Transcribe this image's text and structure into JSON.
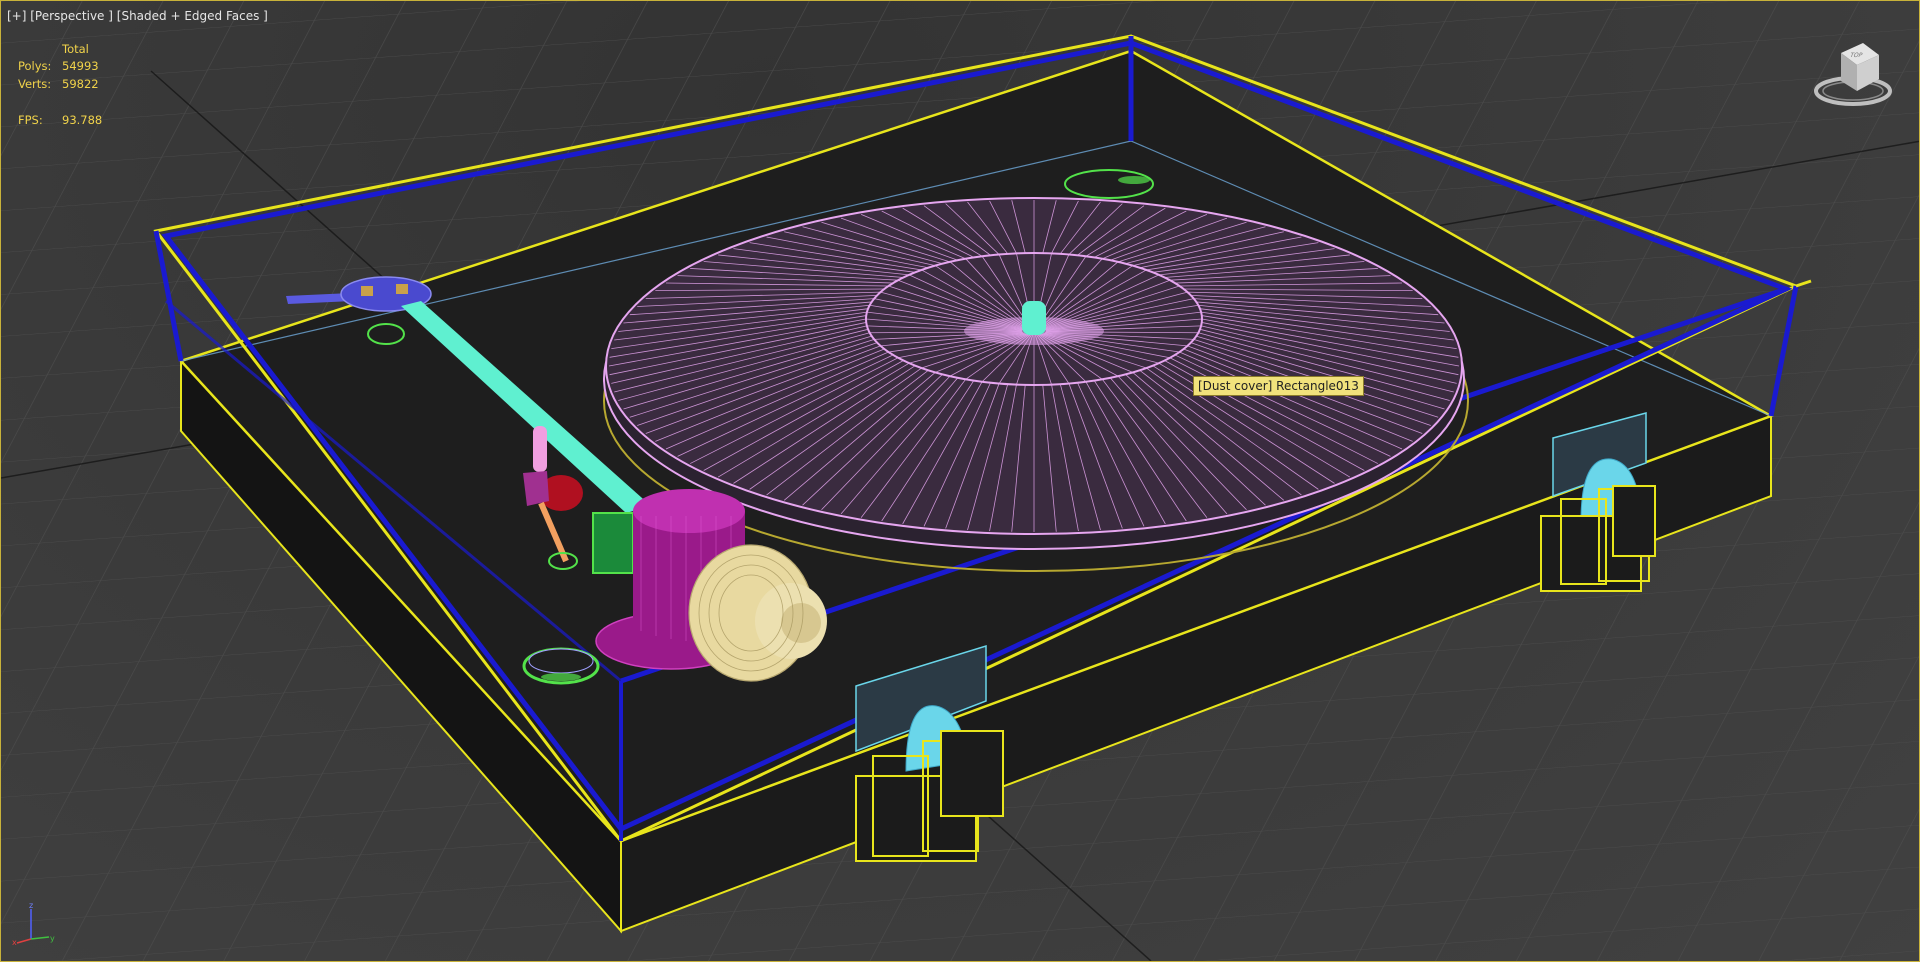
{
  "viewport": {
    "label_plus": "[+]",
    "label_view": "[Perspective ]",
    "label_shading": "[Shaded + Edged Faces ]"
  },
  "stats": {
    "header": "Total",
    "polys_label": "Polys:",
    "polys_value": "54993",
    "verts_label": "Verts:",
    "verts_value": "59822",
    "fps_label": "FPS:",
    "fps_value": "93.788"
  },
  "tooltip": {
    "text": "[Dust cover] Rectangle013"
  },
  "viewcube": {
    "label": "TOP"
  },
  "axis": {
    "z": "z",
    "x": "x",
    "y": "y"
  },
  "colors": {
    "frame": "#c8b23a",
    "selected": "#e8e51c",
    "dust_cover": "#1a1ad0",
    "platter": "#e6a6f0",
    "tonearm": "#5ff0d0",
    "counterweight": "#9a1a8a",
    "knob": "#e8d9a0",
    "hinge": "#6ad6ea",
    "green": "#53e24a"
  },
  "icons": [
    "viewcube-icon",
    "axis-tripod-icon"
  ]
}
